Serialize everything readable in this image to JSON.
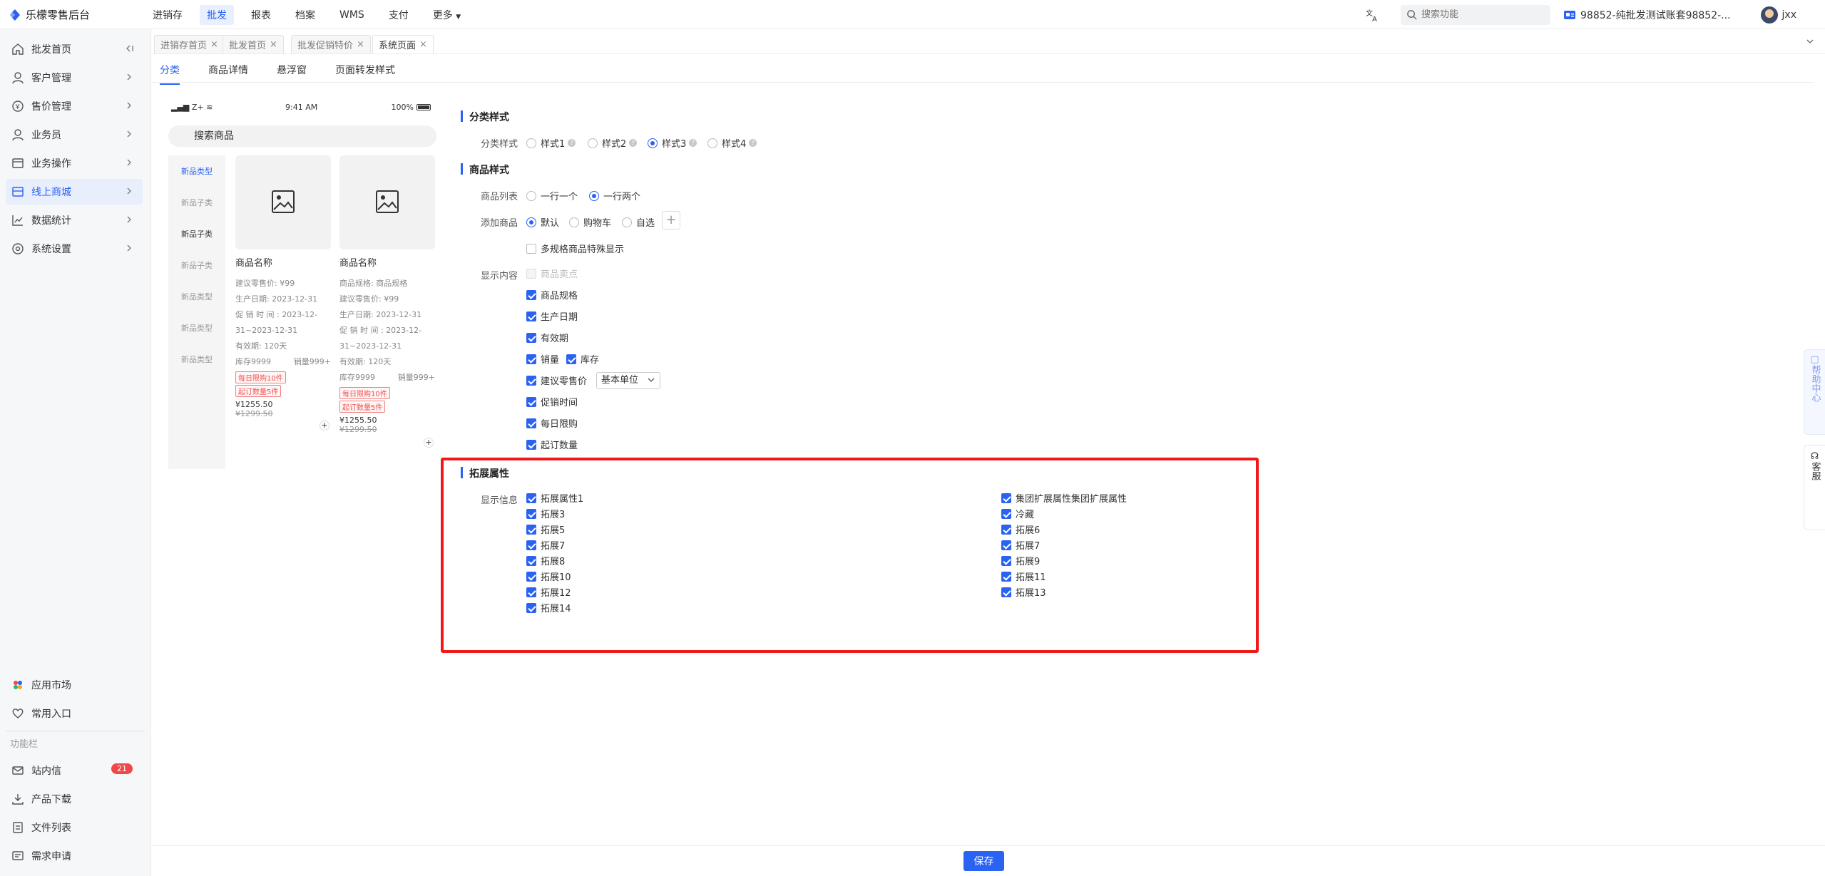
{
  "app": {
    "title": "乐檬零售后台"
  },
  "topnav": [
    {
      "label": "进销存",
      "active": false
    },
    {
      "label": "批发",
      "active": true
    },
    {
      "label": "报表",
      "active": false
    },
    {
      "label": "档案",
      "active": false
    },
    {
      "label": "WMS",
      "active": false
    },
    {
      "label": "支付",
      "active": false
    },
    {
      "label": "更多",
      "active": false
    }
  ],
  "search": {
    "placeholder": "搜索功能"
  },
  "account": {
    "name": "98852-纯批发测试账套98852-..."
  },
  "user": {
    "name": "jxx"
  },
  "sidebar": {
    "items": [
      {
        "label": "批发首页",
        "icon": "home-icon"
      },
      {
        "label": "客户管理",
        "icon": "user-icon"
      },
      {
        "label": "售价管理",
        "icon": "price-icon"
      },
      {
        "label": "业务员",
        "icon": "person-icon"
      },
      {
        "label": "业务操作",
        "icon": "folder-icon"
      },
      {
        "label": "线上商城",
        "icon": "store-icon",
        "active": true
      },
      {
        "label": "数据统计",
        "icon": "chart-icon"
      },
      {
        "label": "系统设置",
        "icon": "settings-icon"
      }
    ],
    "bottom": [
      {
        "label": "应用市场",
        "icon": "app-market-icon"
      },
      {
        "label": "常用入口",
        "icon": "heart-icon"
      }
    ],
    "section_label": "功能栏",
    "func": [
      {
        "label": "站内信",
        "icon": "message-icon",
        "badge": "21"
      },
      {
        "label": "产品下载",
        "icon": "download-icon"
      },
      {
        "label": "文件列表",
        "icon": "file-list-icon"
      },
      {
        "label": "需求申请",
        "icon": "request-icon"
      }
    ]
  },
  "page_tabs": [
    {
      "label": "进销存首页"
    },
    {
      "label": "批发首页"
    },
    {
      "label": "批发促销特价"
    },
    {
      "label": "系统页面",
      "active": true
    }
  ],
  "sub_tabs": [
    {
      "label": "分类",
      "active": true
    },
    {
      "label": "商品详情"
    },
    {
      "label": "悬浮窗"
    },
    {
      "label": "页面转发样式"
    }
  ],
  "phone": {
    "carrier": "Z+",
    "time": "9:41 AM",
    "battery": "100%",
    "search_text": "搜索商品",
    "categories": [
      "新品类型",
      "新品子类",
      "新品子类",
      "新品子类",
      "新品类型",
      "新品类型",
      "新品类型"
    ],
    "cards": [
      {
        "name": "商品名称",
        "lines": [
          "建议零售价: ¥99",
          "生产日期: 2023-12-31",
          "促 销 时 间 : 2023-12-31~2023-12-31",
          "有效期: 120天"
        ],
        "stock": "库存9999",
        "sales": "销量999+",
        "tags": [
          "每日限购10件",
          "起订数量5件"
        ],
        "price": "¥1255.50",
        "old_price": "¥1299.50"
      },
      {
        "name": "商品名称",
        "lines": [
          "商品规格: 商品规格",
          "建议零售价: ¥99",
          "生产日期: 2023-12-31",
          "促 销 时 间 : 2023-12-31~2023-12-31",
          "有效期: 120天"
        ],
        "stock": "库存9999",
        "sales": "销量999+",
        "tags": [
          "每日限购10件",
          "起订数量5件"
        ],
        "price": "¥1255.50",
        "old_price": "¥1299.50"
      }
    ]
  },
  "settings": {
    "category_style": {
      "title": "分类样式",
      "label": "分类样式",
      "options": [
        "样式1",
        "样式2",
        "样式3",
        "样式4"
      ],
      "selected": "样式3"
    },
    "product_style": {
      "title": "商品样式",
      "list_label": "商品列表",
      "list_options": [
        "一行一个",
        "一行两个"
      ],
      "list_selected": "一行两个",
      "add_label": "添加商品",
      "add_options": [
        "默认",
        "购物车",
        "自选"
      ],
      "add_selected": "默认",
      "multi_spec": "多规格商品特殊显示",
      "display_label": "显示内容",
      "display_items": [
        {
          "label": "商品卖点",
          "checked": false,
          "disabled": true
        },
        {
          "label": "商品规格",
          "checked": true
        },
        {
          "label": "生产日期",
          "checked": true
        },
        {
          "label": "有效期",
          "checked": true
        },
        {
          "label": "销量",
          "checked": true
        },
        {
          "label": "库存",
          "checked": true
        },
        {
          "label": "建议零售价",
          "checked": true
        },
        {
          "label": "促销时间",
          "checked": true
        },
        {
          "label": "每日限购",
          "checked": true
        },
        {
          "label": "起订数量",
          "checked": true
        }
      ],
      "unit_select": "基本单位"
    },
    "extension": {
      "title": "拓展属性",
      "label": "显示信息",
      "left": [
        "拓展属性1",
        "拓展3",
        "拓展5",
        "拓展7",
        "拓展8",
        "拓展10",
        "拓展12",
        "拓展14"
      ],
      "right": [
        "集团扩展属性集团扩展属性",
        "冷藏",
        "拓展6",
        "拓展7",
        "拓展9",
        "拓展11",
        "拓展13"
      ]
    }
  },
  "footer": {
    "save_label": "保存"
  },
  "side_widgets": {
    "help": "帮助中心",
    "service": "客服"
  },
  "colors": {
    "accent": "#2a62f2",
    "highlight_box": "#f01818"
  }
}
